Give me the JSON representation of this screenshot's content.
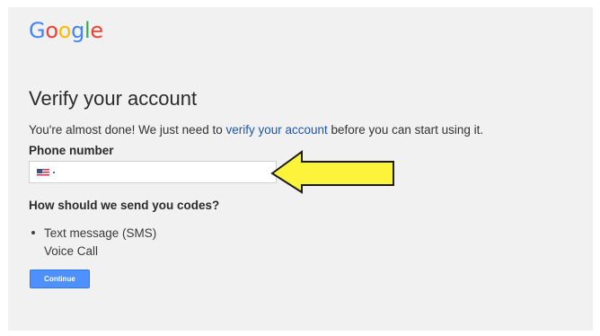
{
  "brand": {
    "logo_letters": [
      {
        "char": "G",
        "color": "#4285f4"
      },
      {
        "char": "o",
        "color": "#ea4335"
      },
      {
        "char": "o",
        "color": "#fbbc05"
      },
      {
        "char": "g",
        "color": "#4285f4"
      },
      {
        "char": "l",
        "color": "#34a853"
      },
      {
        "char": "e",
        "color": "#ea4335"
      }
    ]
  },
  "page": {
    "title": "Verify your account",
    "intro_before": "You're almost done! We just need to ",
    "intro_link": "verify your account",
    "intro_after": " before you can start using it."
  },
  "phone": {
    "label": "Phone number",
    "country_flag": "us-flag-icon",
    "value": "",
    "placeholder": ""
  },
  "codes": {
    "label": "How should we send you codes?",
    "options": [
      {
        "label": "Text message (SMS)",
        "selected": true
      },
      {
        "label": "Voice Call",
        "selected": false
      }
    ]
  },
  "actions": {
    "continue_label": "Continue"
  },
  "annotation": {
    "icon": "left-arrow-icon",
    "fill_color": "#fbf43b",
    "stroke_color": "#1a1a1a"
  },
  "colors": {
    "link": "#1a56b4",
    "button": "#4d90fe",
    "background": "#f1f1f1"
  }
}
